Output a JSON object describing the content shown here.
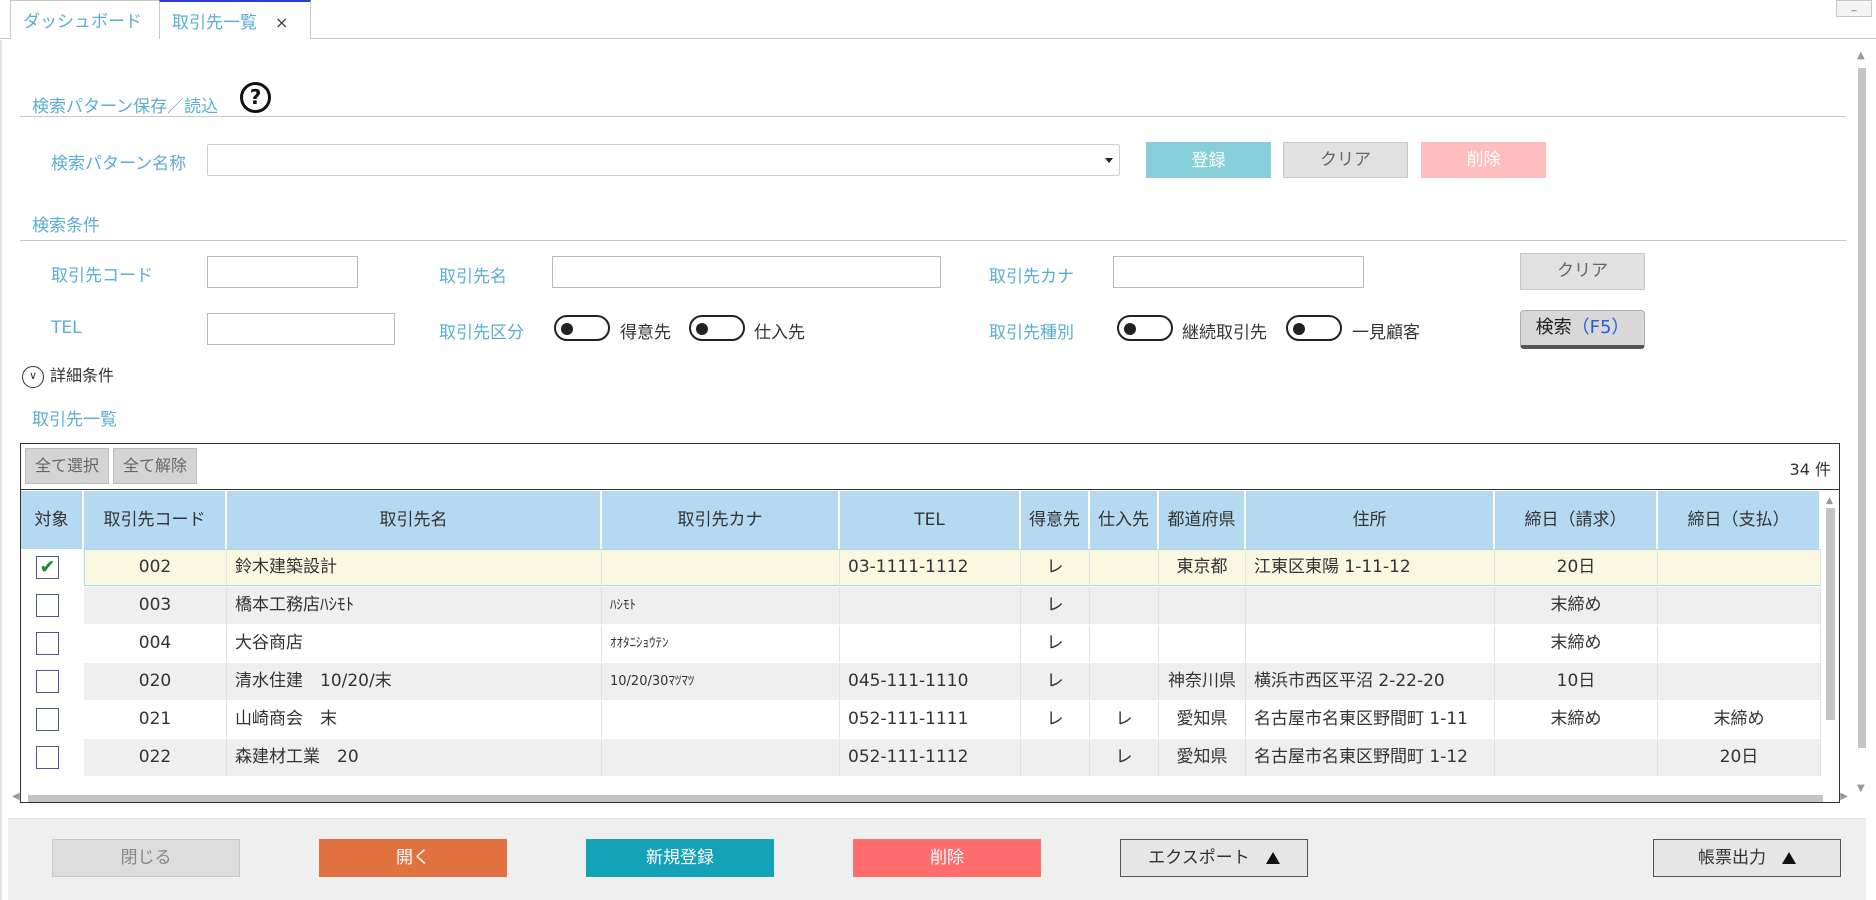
{
  "tabs": [
    {
      "label": "ダッシュボード"
    },
    {
      "label": "取引先一覧",
      "close": "×"
    }
  ],
  "window": {
    "minimize": "_"
  },
  "pattern_section": {
    "title": "検索パターン保存／読込",
    "help": "?",
    "name_label": "検索パターン名称",
    "name_value": "",
    "register": "登録",
    "clear": "クリア",
    "delete": "削除"
  },
  "conditions": {
    "title": "検索条件",
    "code_label": "取引先コード",
    "name_label": "取引先名",
    "kana_label": "取引先カナ",
    "tel_label": "TEL",
    "category_label": "取引先区分",
    "category_opt1": "得意先",
    "category_opt2": "仕入先",
    "type_label": "取引先種別",
    "type_opt1": "継続取引先",
    "type_opt2": "一見顧客",
    "clear": "クリア",
    "search": "検索",
    "search_key": "（F5）",
    "detail": "詳細条件"
  },
  "list": {
    "title": "取引先一覧",
    "select_all": "全て選択",
    "deselect_all": "全て解除",
    "count": "34 件",
    "columns": [
      "対象",
      "取引先コード",
      "取引先名",
      "取引先カナ",
      "TEL",
      "得意先",
      "仕入先",
      "都道府県",
      "住所",
      "締日（請求）",
      "締日（支払）"
    ],
    "rows": [
      {
        "checked": "✔",
        "code": "002",
        "name": "鈴木建築設計",
        "kana": "",
        "tel": "03-1111-1112",
        "customer": "レ",
        "supplier": "",
        "pref": "東京都",
        "address": "江東区東陽 1-11-12",
        "close_bill": "20日",
        "close_pay": ""
      },
      {
        "checked": "",
        "code": "003",
        "name": "橋本工務店ﾊｼﾓﾄ",
        "kana": "ﾊｼﾓﾄ",
        "tel": "",
        "customer": "レ",
        "supplier": "",
        "pref": "",
        "address": "",
        "close_bill": "末締め",
        "close_pay": ""
      },
      {
        "checked": "",
        "code": "004",
        "name": "大谷商店",
        "kana": "ｵｵﾀﾆｼｮｳﾃﾝ",
        "tel": "",
        "customer": "レ",
        "supplier": "",
        "pref": "",
        "address": "",
        "close_bill": "末締め",
        "close_pay": ""
      },
      {
        "checked": "",
        "code": "020",
        "name": "清水住建　10/20/末",
        "kana": "10/20/30ﾏﾂﾏﾂ",
        "tel": "045-111-1110",
        "customer": "レ",
        "supplier": "",
        "pref": "神奈川県",
        "address": "横浜市西区平沼 2-22-20",
        "close_bill": "10日",
        "close_pay": ""
      },
      {
        "checked": "",
        "code": "021",
        "name": "山崎商会　末",
        "kana": "",
        "tel": "052-111-1111",
        "customer": "レ",
        "supplier": "レ",
        "pref": "愛知県",
        "address": "名古屋市名東区野間町 1-11",
        "close_bill": "末締め",
        "close_pay": "末締め"
      },
      {
        "checked": "",
        "code": "022",
        "name": "森建材工業　20",
        "kana": "",
        "tel": "052-111-1112",
        "customer": "",
        "supplier": "レ",
        "pref": "愛知県",
        "address": "名古屋市名東区野間町 1-12",
        "close_bill": "",
        "close_pay": "20日"
      }
    ]
  },
  "footer": {
    "close": "閉じる",
    "open": "開く",
    "new": "新規登録",
    "delete": "削除",
    "export": "エクスポート",
    "report": "帳票出力"
  }
}
